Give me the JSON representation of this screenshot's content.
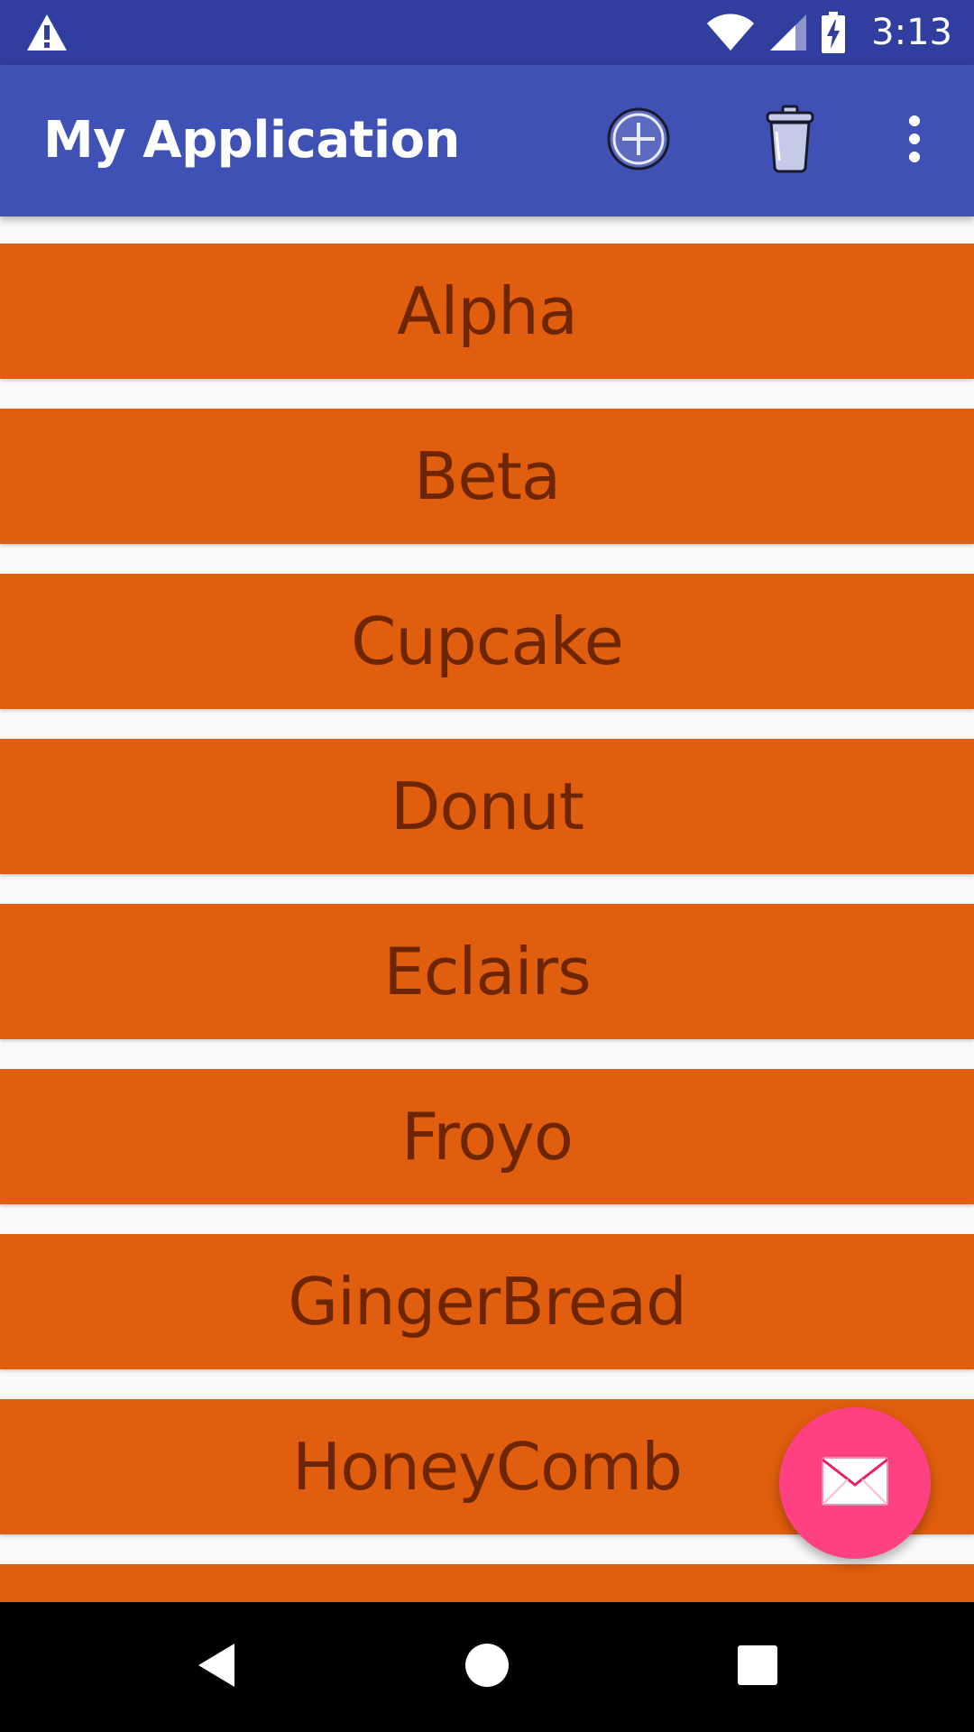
{
  "status_bar": {
    "time": "3:13",
    "icons": [
      "warning-icon",
      "wifi-icon",
      "cellular-signal-icon",
      "battery-charging-icon"
    ]
  },
  "app_bar": {
    "title": "My Application",
    "actions": [
      "add-circle-icon",
      "trash-icon",
      "more-vert-icon"
    ]
  },
  "list": {
    "items": [
      {
        "label": "Alpha"
      },
      {
        "label": "Beta"
      },
      {
        "label": "Cupcake"
      },
      {
        "label": "Donut"
      },
      {
        "label": "Eclairs"
      },
      {
        "label": "Froyo"
      },
      {
        "label": "GingerBread"
      },
      {
        "label": "HoneyComb"
      },
      {
        "label": ""
      }
    ]
  },
  "fab": {
    "icon": "mail-icon"
  },
  "nav_bar": {
    "buttons": [
      "back-icon",
      "home-icon",
      "recents-icon"
    ]
  },
  "colors": {
    "status_bar": "#303f9f",
    "app_bar": "#3f51b5",
    "list_item": "#e05e0d",
    "list_text": "#6e2602",
    "fab": "#ff4081",
    "background": "#fafafa"
  }
}
